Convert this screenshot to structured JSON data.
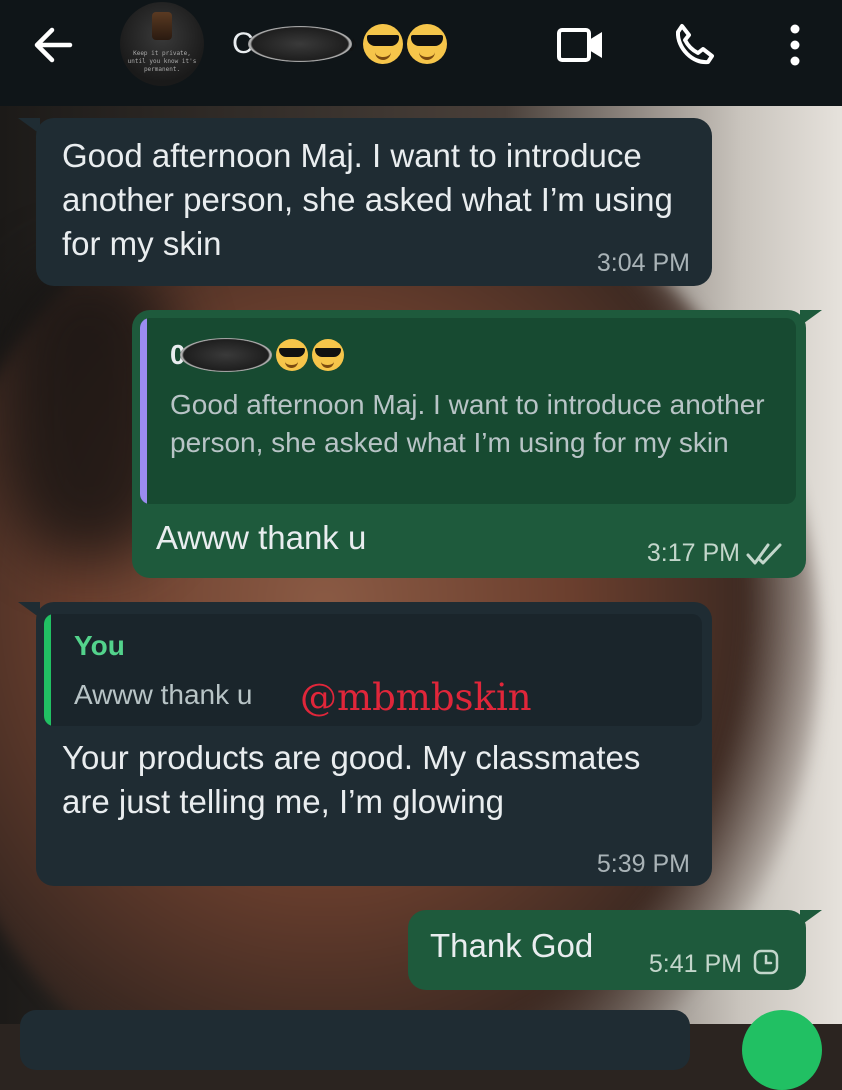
{
  "header": {
    "contact_initial": "C",
    "contact_initial_icon": "scribble-redaction",
    "status_icon": "music-note-icon",
    "emoji": [
      "smiling-face-with-sunglasses",
      "smiling-face-with-sunglasses"
    ],
    "avatar_caption": "Keep it private, until you know it's permanent.",
    "icons": [
      "back-arrow-icon",
      "video-call-icon",
      "phone-icon",
      "more-options-icon"
    ]
  },
  "messages": [
    {
      "direction": "incoming",
      "text": "Good afternoon Maj. I want to introduce another person, she asked what I’m using for my skin",
      "time": "3:04 PM"
    },
    {
      "direction": "outgoing",
      "quote_author": "0",
      "quote_text": "Good afternoon Maj. I want to introduce another person, she asked what I’m using for my skin",
      "text": "Awww thank u",
      "time": "3:17 PM",
      "status": "read-double-check"
    },
    {
      "direction": "incoming",
      "quote_author": "You",
      "quote_text": "Awww thank u",
      "text": "Your products are good. My classmates are just telling me, I’m glowing",
      "time": "5:39 PM"
    },
    {
      "direction": "outgoing",
      "text": "Thank God",
      "time": "5:41 PM",
      "status": "pending-clock"
    }
  ],
  "watermark": "@mbmbskin",
  "colors": {
    "header_bg": "#0f1518",
    "incoming_bubble": "#1f2c33",
    "outgoing_bubble": "#1e5a3c",
    "quote_bar_outgoing": "#9b8cf0",
    "quote_bar_incoming": "#21c063",
    "watermark": "#e0263a"
  }
}
